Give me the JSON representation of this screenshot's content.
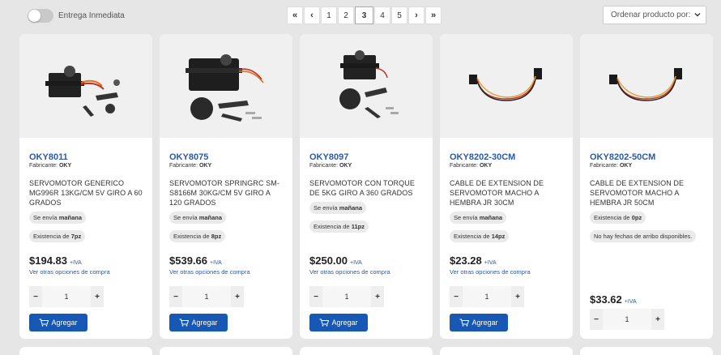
{
  "filter": {
    "label": "Entrega Inmediata"
  },
  "pagination": {
    "first": "«",
    "prev": "‹",
    "pages": [
      "1",
      "2",
      "3",
      "4",
      "5"
    ],
    "current": "3",
    "next": "›",
    "last": "»"
  },
  "sort": {
    "label": "Ordenar producto por:"
  },
  "products": [
    {
      "sku": "OKY8011",
      "mfr_label": "Fabricante:",
      "mfr": "OKY",
      "desc": "SERVOMOTOR GENERICO MG996R 13KG/CM 5V GIRO A 60 GRADOS",
      "ship_pre": "Se envía ",
      "ship": "mañana",
      "stock_pre": "Existencia de ",
      "stock": "7pz",
      "price": "$194.83",
      "iva": "+IVA",
      "opts": "Ver otras opciones de compra",
      "qty": "1",
      "add": "Agregar"
    },
    {
      "sku": "OKY8075",
      "mfr_label": "Fabricante:",
      "mfr": "OKY",
      "desc": "SERVOMOTOR SPRINGRC SM-S8166M 30KG/CM 5V GIRO A 120 GRADOS",
      "ship_pre": "Se envía ",
      "ship": "mañana",
      "stock_pre": "Existencia de ",
      "stock": "8pz",
      "price": "$539.66",
      "iva": "+IVA",
      "opts": "Ver otras opciones de compra",
      "qty": "1",
      "add": "Agregar"
    },
    {
      "sku": "OKY8097",
      "mfr_label": "Fabricante:",
      "mfr": "OKY",
      "desc": "SERVOMOTOR CON TORQUE DE 5KG GIRO A 360 GRADOS",
      "ship_pre": "Se envía ",
      "ship": "mañana",
      "stock_pre": "Existencia de ",
      "stock": "11pz",
      "price": "$250.00",
      "iva": "+IVA",
      "opts": "Ver otras opciones de compra",
      "qty": "1",
      "add": "Agregar"
    },
    {
      "sku": "OKY8202-30CM",
      "mfr_label": "Fabricante:",
      "mfr": "OKY",
      "desc": "CABLE DE EXTENSION DE SERVOMOTOR MACHO A HEMBRA JR 30CM",
      "ship_pre": "Se envía ",
      "ship": "mañana",
      "stock_pre": "Existencia de ",
      "stock": "14pz",
      "price": "$23.28",
      "iva": "+IVA",
      "opts": "Ver otras opciones de compra",
      "qty": "1",
      "add": "Agregar"
    },
    {
      "sku": "OKY8202-50CM",
      "mfr_label": "Fabricante:",
      "mfr": "OKY",
      "desc": "CABLE DE EXTENSION DE SERVOMOTOR MACHO A HEMBRA JR 50CM",
      "stock_pre": "Existencia de ",
      "stock": "0pz",
      "no_arrival": "No hay fechas de arribo disponibles.",
      "price": "$33.62",
      "iva": "+IVA",
      "qty": "1"
    }
  ],
  "qty_controls": {
    "minus": "−",
    "plus": "+"
  },
  "colors": {
    "accent": "#1658b4",
    "link": "#2a5aa8",
    "background": "#e6e6e6"
  },
  "icons": {
    "cart": "cart-plus-icon",
    "chevron": "chevron-down-icon"
  }
}
